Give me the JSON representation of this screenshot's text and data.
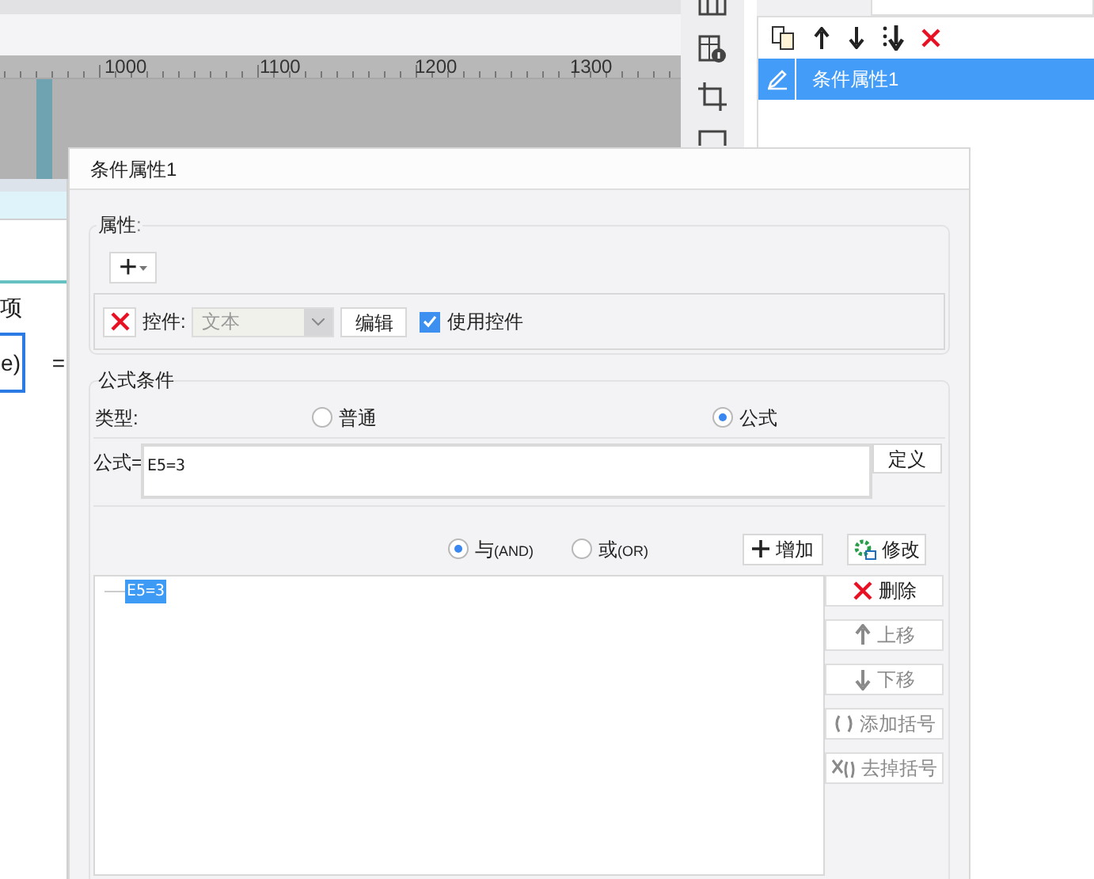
{
  "ruler": {
    "labels": [
      "1000",
      "1100",
      "1200",
      "1300"
    ]
  },
  "sheet": {
    "header_text": "项",
    "cell_value": "e)",
    "operator": "="
  },
  "right_panel": {
    "items": [
      {
        "label": "条件属性1",
        "selected": true
      }
    ]
  },
  "dialog": {
    "title": "条件属性1",
    "property_group": {
      "legend": "属性",
      "colon": ":",
      "add_button": "+",
      "control_label": "控件:",
      "control_select": {
        "value": "文本",
        "disabled": true
      },
      "edit_button": "编辑",
      "use_control": {
        "label": "使用控件",
        "checked": true
      }
    },
    "formula_group": {
      "legend": "公式条件",
      "type_label": "类型:",
      "types": [
        {
          "label": "普通",
          "selected": false
        },
        {
          "label": "公式",
          "selected": true
        }
      ],
      "formula_label": "公式=",
      "formula_value": "E5=3",
      "define_button": "定义"
    },
    "logic": [
      {
        "label": "与",
        "suffix": "(AND)",
        "selected": true
      },
      {
        "label": "或",
        "suffix": "(OR)",
        "selected": false
      }
    ],
    "add_button": "增加",
    "modify_button": "修改",
    "conditions": [
      {
        "text": "E5=3",
        "selected": true
      }
    ],
    "side_buttons": [
      {
        "kind": "delete",
        "label": "删除",
        "disabled": false
      },
      {
        "kind": "up",
        "label": "上移",
        "disabled": true
      },
      {
        "kind": "down",
        "label": "下移",
        "disabled": true
      },
      {
        "kind": "add-paren",
        "label": "添加括号",
        "disabled": true
      },
      {
        "kind": "remove-paren",
        "label": "去掉括号",
        "disabled": true
      }
    ]
  }
}
